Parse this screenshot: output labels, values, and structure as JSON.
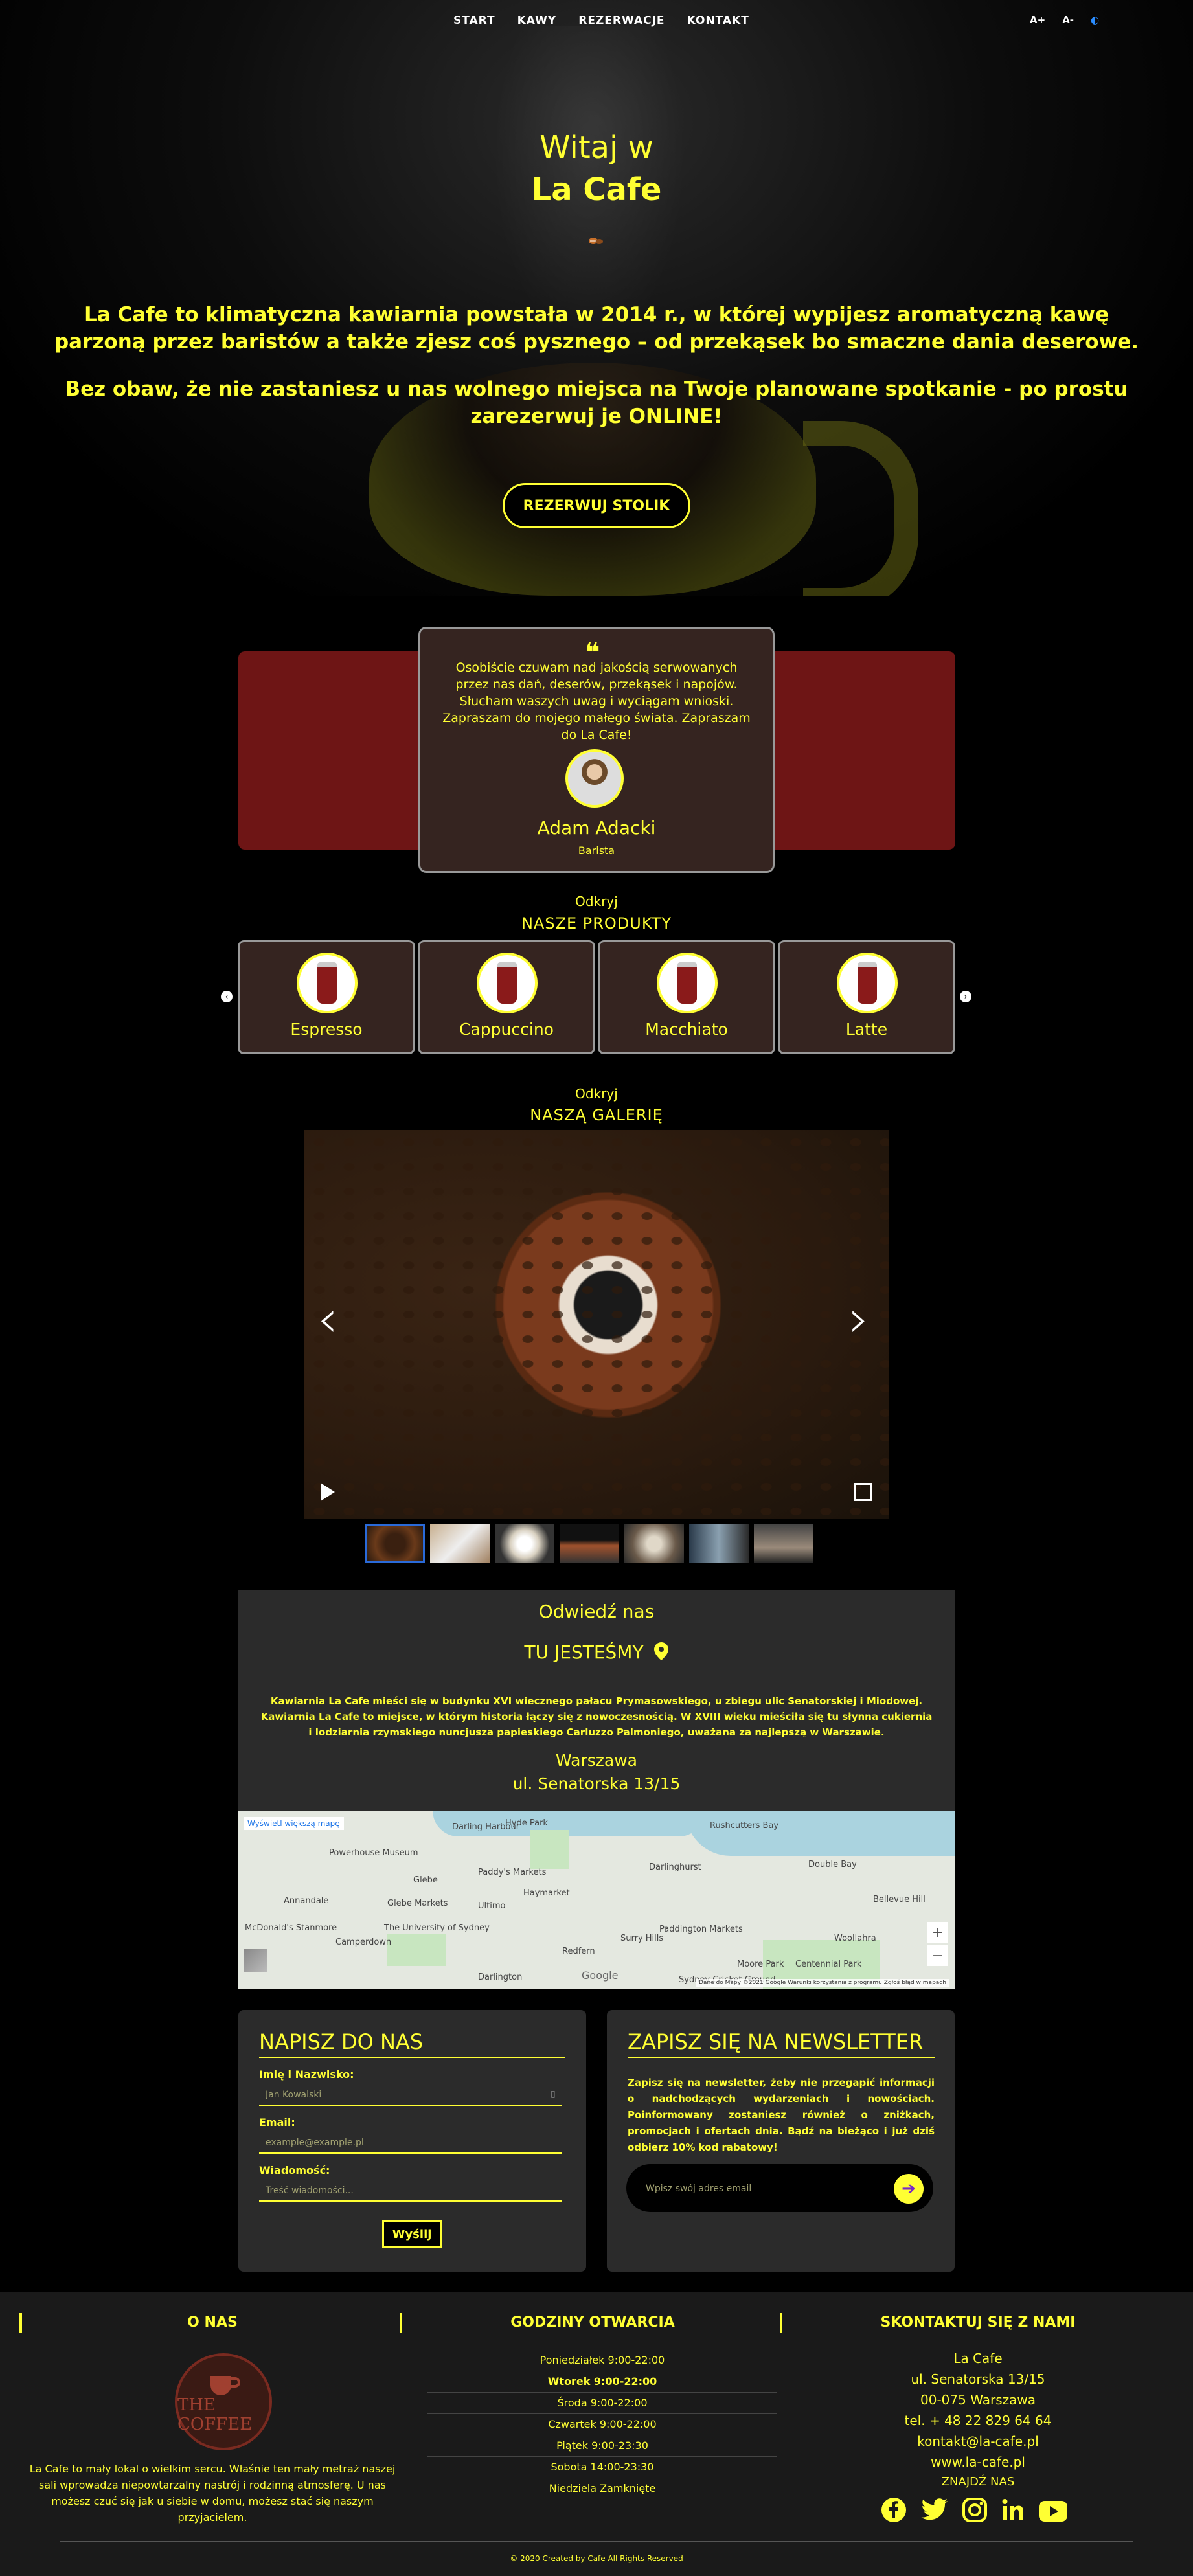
{
  "nav": {
    "items": [
      "START",
      "KAWY",
      "REZERWACJE",
      "KONTAKT"
    ],
    "font_plus": "A+",
    "font_minus": "A-",
    "contrast": "◐"
  },
  "hero": {
    "title_line1": "Witaj w",
    "title_line2": "La Cafe",
    "para1": "La Cafe to klimatyczna kawiarnia powstała w 2014 r., w której wypijesz aromatyczną kawę parzoną przez baristów a także zjesz coś pysznego – od przekąsek bo smaczne dania deserowe.",
    "para2": "Bez obaw, że nie zastaniesz u nas wolnego miejsca na Twoje planowane spotkanie - po prostu zarezerwuj je ONLINE!",
    "button": "REZERWUJ STOLIK"
  },
  "testimonial": {
    "quote_mark": "❝",
    "text": "Osobiście czuwam nad jakością serwowanych przez nas dań, deserów, przekąsek i napojów. Słucham waszych uwag i wyciągam wnioski. Zapraszam do mojego małego świata. Zapraszam do La Cafe!",
    "name": "Adam Adacki",
    "role": "Barista"
  },
  "products": {
    "subtitle": "Odkryj",
    "title": "NASZE PRODUKTY",
    "items": [
      "Espresso",
      "Cappuccino",
      "Macchiato",
      "Latte"
    ],
    "prev": "‹",
    "next": "›"
  },
  "gallery": {
    "subtitle": "Odkryj",
    "title": "NASZĄ GALERIĘ",
    "prev": "‹",
    "next": "›"
  },
  "visit": {
    "title": "Odwiedź nas",
    "here": "TU JESTEŚMY",
    "description": "Kawiarnia La Cafe mieści się w budynku XVI wiecznego pałacu Prymasowskiego, u zbiegu ulic Senatorskiej i Miodowej. Kawiarnia La Cafe to miejsce, w którym historia łączy się z nowoczesnością. W XVIII wieku mieściła się tu słynna cukiernia i lodziarnia rzymskiego nuncjusza papieskiego Carluzzo Palmoniego, uważana za najlepszą w Warszawie.",
    "city": "Warszawa",
    "street": "ul. Senatorska 13/15"
  },
  "map": {
    "link": "Wyświetl większą mapę",
    "labels": [
      "Hyde Park",
      "Darling Harbour",
      "Rushcutters Bay",
      "Powerhouse Museum",
      "Paddy's Markets",
      "Darlinghurst",
      "Double Bay",
      "Glebe",
      "Haymarket",
      "Glebe Markets",
      "Annandale",
      "Ultimo",
      "Surry Hills",
      "Bellevue Hill",
      "McDonald's Stanmore",
      "The University of Sydney",
      "Paddington Markets",
      "Camperdown",
      "Redfern",
      "Woollahra",
      "Darlington",
      "Sydney Cricket Ground",
      "Moore Park",
      "Centennial Park"
    ],
    "footer": "Dane do Mapy ©2021 Google   Warunki korzystania z programu   Zgłoś błąd w mapach",
    "zoom_in": "+",
    "zoom_out": "−",
    "google": "Google"
  },
  "contact_form": {
    "title": "NAPISZ DO NAS",
    "name_label": "Imię i Nazwisko:",
    "name_placeholder": "Jan Kowalski",
    "email_label": "Email:",
    "email_placeholder": "example@example.pl",
    "message_label": "Wiadomość:",
    "message_placeholder": "Treść wiadomości...",
    "send": "Wyślij"
  },
  "newsletter": {
    "title": "ZAPISZ SIĘ NA NEWSLETTER",
    "text": "Zapisz się na newsletter, żeby nie przegapić informacji o nadchodzących wydarzeniach i nowościach. Poinformowany zostaniesz również o zniżkach, promocjach i ofertach dnia. Bądź na bieżąco i już dziś odbierz 10% kod rabatowy!",
    "placeholder": "Wpisz swój adres email",
    "submit": "➔"
  },
  "footer": {
    "about_title": "O NAS",
    "logo_text": "THE COFFEE",
    "about_text": "La Cafe to mały lokal o wielkim sercu. Właśnie ten mały metraż naszej sali wprowadza niepowtarzalny nastrój i rodzinną atmosferę. U nas możesz czuć się jak u siebie w domu, możesz stać się naszym przyjacielem.",
    "hours_title": "GODZINY OTWARCIA",
    "hours": [
      "Poniedziałek 9:00-22:00",
      "Wtorek 9:00-22:00",
      "Środa 9:00-22:00",
      "Czwartek 9:00-22:00",
      "Piątek 9:00-23:30",
      "Sobota 14:00-23:30",
      "Niedziela Zamknięte"
    ],
    "contact_title": "SKONTAKTUJ SIĘ Z NAMI",
    "contact": [
      "La Cafe",
      "ul. Senatorska 13/15",
      "00-075 Warszawa",
      "tel. + 48 22 829 64 64",
      "kontakt@la-cafe.pl",
      "www.la-cafe.pl",
      "ZNAJDŹ NAS"
    ],
    "copyright": "© 2020 Created by Cafe All Rights Reserved"
  },
  "colors": {
    "accent": "#ffff33",
    "background": "#000000",
    "panel": "#2b2b2b",
    "card": "#352420",
    "testimonial_band": "#6e1515"
  }
}
